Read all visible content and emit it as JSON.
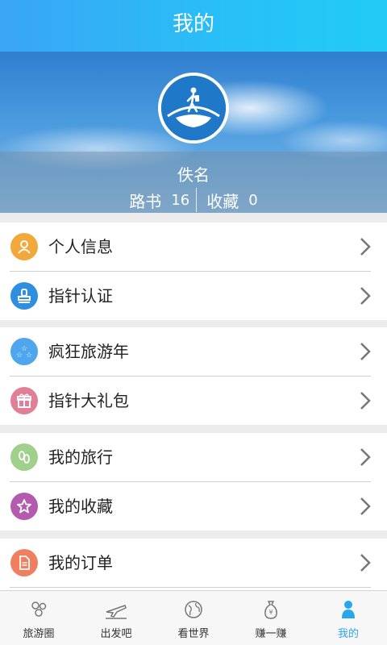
{
  "header": {
    "title": "我的"
  },
  "profile": {
    "username": "佚名",
    "stats": [
      {
        "label": "路书",
        "value": "16"
      },
      {
        "label": "收藏",
        "value": "0"
      }
    ]
  },
  "menu": {
    "group1": [
      {
        "label": "个人信息",
        "icon": "person-icon",
        "color": "#f2a83a"
      },
      {
        "label": "指针认证",
        "icon": "stamp-icon",
        "color": "#2e8fe0"
      }
    ],
    "group2": [
      {
        "label": "疯狂旅游年",
        "icon": "stars-icon",
        "color": "#4ea6ee"
      },
      {
        "label": "指针大礼包",
        "icon": "gift-icon",
        "color": "#e07f95"
      }
    ],
    "group3": [
      {
        "label": "我的旅行",
        "icon": "footprints-icon",
        "color": "#9fd18a"
      },
      {
        "label": "我的收藏",
        "icon": "star-icon",
        "color": "#b45bb0"
      }
    ],
    "group4": [
      {
        "label": "我的订单",
        "icon": "document-icon",
        "color": "#ef7f5e"
      }
    ]
  },
  "tabs": [
    {
      "label": "旅游圈",
      "icon": "people-icon",
      "active": false
    },
    {
      "label": "出发吧",
      "icon": "plane-icon",
      "active": false
    },
    {
      "label": "看世界",
      "icon": "globe-icon",
      "active": false
    },
    {
      "label": "赚一赚",
      "icon": "money-bag-icon",
      "active": false
    },
    {
      "label": "我的",
      "icon": "user-icon",
      "active": true
    }
  ],
  "colors": {
    "accent": "#2aa6ee",
    "topbar": "#28c0f7"
  }
}
